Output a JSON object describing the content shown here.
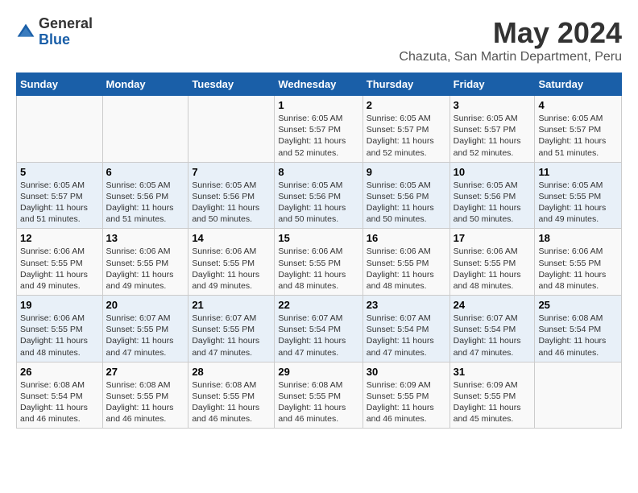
{
  "logo": {
    "general": "General",
    "blue": "Blue"
  },
  "title": "May 2024",
  "location": "Chazuta, San Martin Department, Peru",
  "weekdays": [
    "Sunday",
    "Monday",
    "Tuesday",
    "Wednesday",
    "Thursday",
    "Friday",
    "Saturday"
  ],
  "weeks": [
    [
      {
        "day": "",
        "info": ""
      },
      {
        "day": "",
        "info": ""
      },
      {
        "day": "",
        "info": ""
      },
      {
        "day": "1",
        "info": "Sunrise: 6:05 AM\nSunset: 5:57 PM\nDaylight: 11 hours\nand 52 minutes."
      },
      {
        "day": "2",
        "info": "Sunrise: 6:05 AM\nSunset: 5:57 PM\nDaylight: 11 hours\nand 52 minutes."
      },
      {
        "day": "3",
        "info": "Sunrise: 6:05 AM\nSunset: 5:57 PM\nDaylight: 11 hours\nand 52 minutes."
      },
      {
        "day": "4",
        "info": "Sunrise: 6:05 AM\nSunset: 5:57 PM\nDaylight: 11 hours\nand 51 minutes."
      }
    ],
    [
      {
        "day": "5",
        "info": "Sunrise: 6:05 AM\nSunset: 5:57 PM\nDaylight: 11 hours\nand 51 minutes."
      },
      {
        "day": "6",
        "info": "Sunrise: 6:05 AM\nSunset: 5:56 PM\nDaylight: 11 hours\nand 51 minutes."
      },
      {
        "day": "7",
        "info": "Sunrise: 6:05 AM\nSunset: 5:56 PM\nDaylight: 11 hours\nand 50 minutes."
      },
      {
        "day": "8",
        "info": "Sunrise: 6:05 AM\nSunset: 5:56 PM\nDaylight: 11 hours\nand 50 minutes."
      },
      {
        "day": "9",
        "info": "Sunrise: 6:05 AM\nSunset: 5:56 PM\nDaylight: 11 hours\nand 50 minutes."
      },
      {
        "day": "10",
        "info": "Sunrise: 6:05 AM\nSunset: 5:56 PM\nDaylight: 11 hours\nand 50 minutes."
      },
      {
        "day": "11",
        "info": "Sunrise: 6:05 AM\nSunset: 5:55 PM\nDaylight: 11 hours\nand 49 minutes."
      }
    ],
    [
      {
        "day": "12",
        "info": "Sunrise: 6:06 AM\nSunset: 5:55 PM\nDaylight: 11 hours\nand 49 minutes."
      },
      {
        "day": "13",
        "info": "Sunrise: 6:06 AM\nSunset: 5:55 PM\nDaylight: 11 hours\nand 49 minutes."
      },
      {
        "day": "14",
        "info": "Sunrise: 6:06 AM\nSunset: 5:55 PM\nDaylight: 11 hours\nand 49 minutes."
      },
      {
        "day": "15",
        "info": "Sunrise: 6:06 AM\nSunset: 5:55 PM\nDaylight: 11 hours\nand 48 minutes."
      },
      {
        "day": "16",
        "info": "Sunrise: 6:06 AM\nSunset: 5:55 PM\nDaylight: 11 hours\nand 48 minutes."
      },
      {
        "day": "17",
        "info": "Sunrise: 6:06 AM\nSunset: 5:55 PM\nDaylight: 11 hours\nand 48 minutes."
      },
      {
        "day": "18",
        "info": "Sunrise: 6:06 AM\nSunset: 5:55 PM\nDaylight: 11 hours\nand 48 minutes."
      }
    ],
    [
      {
        "day": "19",
        "info": "Sunrise: 6:06 AM\nSunset: 5:55 PM\nDaylight: 11 hours\nand 48 minutes."
      },
      {
        "day": "20",
        "info": "Sunrise: 6:07 AM\nSunset: 5:55 PM\nDaylight: 11 hours\nand 47 minutes."
      },
      {
        "day": "21",
        "info": "Sunrise: 6:07 AM\nSunset: 5:55 PM\nDaylight: 11 hours\nand 47 minutes."
      },
      {
        "day": "22",
        "info": "Sunrise: 6:07 AM\nSunset: 5:54 PM\nDaylight: 11 hours\nand 47 minutes."
      },
      {
        "day": "23",
        "info": "Sunrise: 6:07 AM\nSunset: 5:54 PM\nDaylight: 11 hours\nand 47 minutes."
      },
      {
        "day": "24",
        "info": "Sunrise: 6:07 AM\nSunset: 5:54 PM\nDaylight: 11 hours\nand 47 minutes."
      },
      {
        "day": "25",
        "info": "Sunrise: 6:08 AM\nSunset: 5:54 PM\nDaylight: 11 hours\nand 46 minutes."
      }
    ],
    [
      {
        "day": "26",
        "info": "Sunrise: 6:08 AM\nSunset: 5:54 PM\nDaylight: 11 hours\nand 46 minutes."
      },
      {
        "day": "27",
        "info": "Sunrise: 6:08 AM\nSunset: 5:55 PM\nDaylight: 11 hours\nand 46 minutes."
      },
      {
        "day": "28",
        "info": "Sunrise: 6:08 AM\nSunset: 5:55 PM\nDaylight: 11 hours\nand 46 minutes."
      },
      {
        "day": "29",
        "info": "Sunrise: 6:08 AM\nSunset: 5:55 PM\nDaylight: 11 hours\nand 46 minutes."
      },
      {
        "day": "30",
        "info": "Sunrise: 6:09 AM\nSunset: 5:55 PM\nDaylight: 11 hours\nand 46 minutes."
      },
      {
        "day": "31",
        "info": "Sunrise: 6:09 AM\nSunset: 5:55 PM\nDaylight: 11 hours\nand 45 minutes."
      },
      {
        "day": "",
        "info": ""
      }
    ]
  ]
}
